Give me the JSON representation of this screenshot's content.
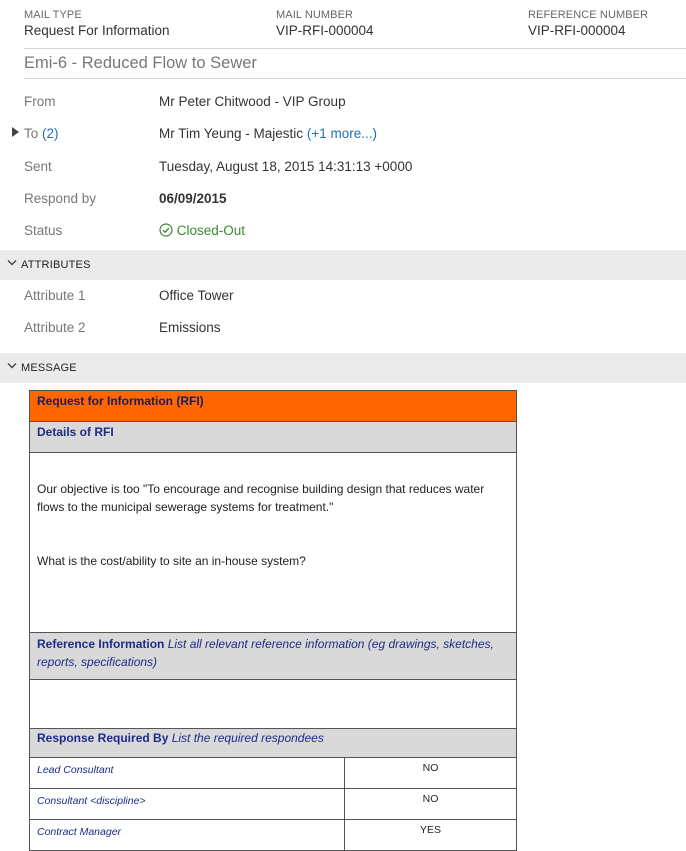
{
  "header": {
    "mail_type_label": "MAIL TYPE",
    "mail_type_value": "Request For Information",
    "mail_number_label": "MAIL NUMBER",
    "mail_number_value": "VIP-RFI-000004",
    "reference_number_label": "REFERENCE NUMBER",
    "reference_number_value": "VIP-RFI-000004"
  },
  "subject": "Emi-6 - Reduced Flow to Sewer",
  "fields": {
    "from_label": "From",
    "from_value": "Mr Peter Chitwood - VIP Group",
    "to_label": "To",
    "to_count": "(2)",
    "to_value": "Mr Tim Yeung - Majestic",
    "to_more": "(+1 more...)",
    "sent_label": "Sent",
    "sent_value": "Tuesday, August 18, 2015 14:31:13 +0000",
    "respond_label": "Respond by",
    "respond_value": "06/09/2015",
    "status_label": "Status",
    "status_value": "Closed-Out"
  },
  "attributes_section": {
    "title": "ATTRIBUTES",
    "attr1_label": "Attribute 1",
    "attr1_value": "Office Tower",
    "attr2_label": "Attribute 2",
    "attr2_value": "Emissions"
  },
  "message_section": {
    "title": "MESSAGE",
    "table_title": "Request for Information (RFI)",
    "details_heading": "Details of RFI",
    "details_paragraph1": "Our objective is too \"To encourage and recognise building design that reduces water flows to the municipal sewerage systems for treatment.\"",
    "details_paragraph2": "What is the cost/ability to site an in-house system?",
    "reference_heading": "Reference Information",
    "reference_hint": "List all relevant reference information (eg drawings, sketches, reports, specifications)",
    "response_heading": "Response Required By",
    "response_hint": "List the required respondees",
    "respondees": [
      {
        "role": "Lead Consultant",
        "value": "NO"
      },
      {
        "role": "Consultant <discipline>",
        "value": "NO"
      },
      {
        "role": "Contract Manager",
        "value": "YES"
      }
    ]
  },
  "colors": {
    "rfi_header": "#ff6600",
    "status_green": "#3a8a2e",
    "link_blue": "#1f6fb5"
  }
}
